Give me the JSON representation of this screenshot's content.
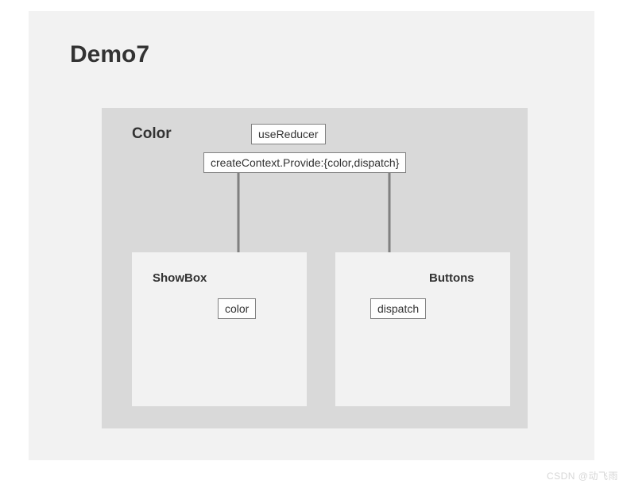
{
  "title": "Demo7",
  "color_box": {
    "title": "Color",
    "useReducer": "useReducer",
    "provide": "createContext.Provide:{color,dispatch}"
  },
  "showbox": {
    "title": "ShowBox",
    "value": "color"
  },
  "buttons": {
    "title": "Buttons",
    "value": "dispatch"
  },
  "watermark": "CSDN @动飞雨"
}
